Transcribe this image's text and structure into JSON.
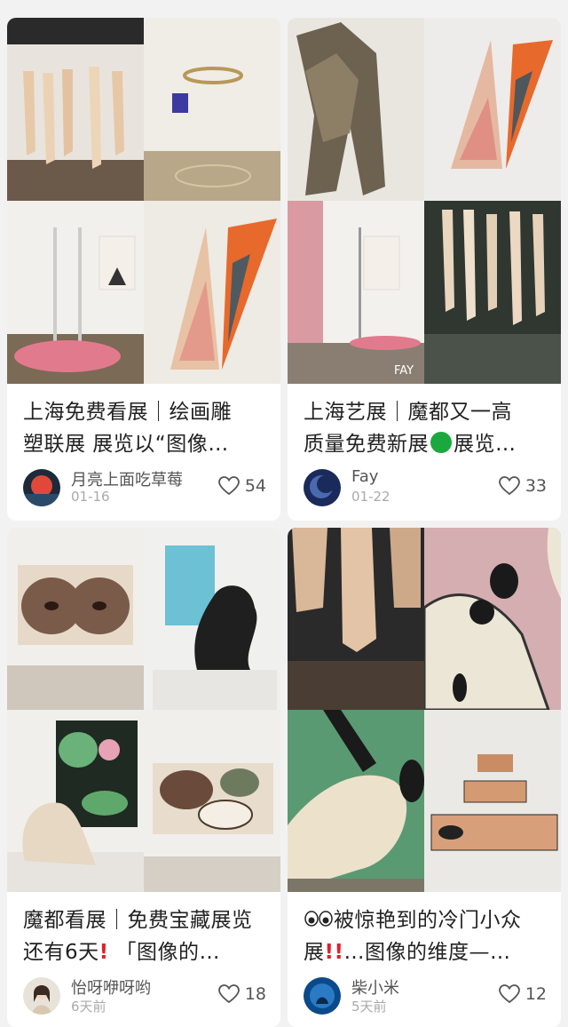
{
  "feed": {
    "cards": [
      {
        "title_line1": "上海免费看展｜绘画雕",
        "title_line2": "塑联展 展览以“图像…",
        "author": "月亮上面吃草莓",
        "date": "01-16",
        "likes": "54",
        "avatar_icon": "red-orb-avatar"
      },
      {
        "title_line1": "上海艺展｜魔都又一高",
        "title_line2_a": "质量免费新展",
        "title_line2_b": "展览…",
        "author": "Fay",
        "date": "01-22",
        "likes": "33",
        "avatar_icon": "blue-moon-avatar",
        "watermark": "FAY"
      },
      {
        "title_line1": "魔都看展｜免费宝藏展览",
        "title_line2_a": "还有6天",
        "title_line2_b": " 「图像的…",
        "author": "怡呀咿呀哟",
        "date": "6天前",
        "likes": "18",
        "avatar_icon": "girl-portrait-avatar"
      },
      {
        "title_line1": "被惊艳到的冷门小众",
        "title_line2_a": "展",
        "title_line2_b": "…图像的维度—…",
        "author": "柴小米",
        "date": "5天前",
        "likes": "12",
        "avatar_icon": "blue-water-avatar"
      }
    ],
    "colors": {
      "background": "#f2f2f2",
      "card": "#ffffff",
      "alert_red": "#e0202a",
      "green_dot": "#1aa83f"
    }
  }
}
